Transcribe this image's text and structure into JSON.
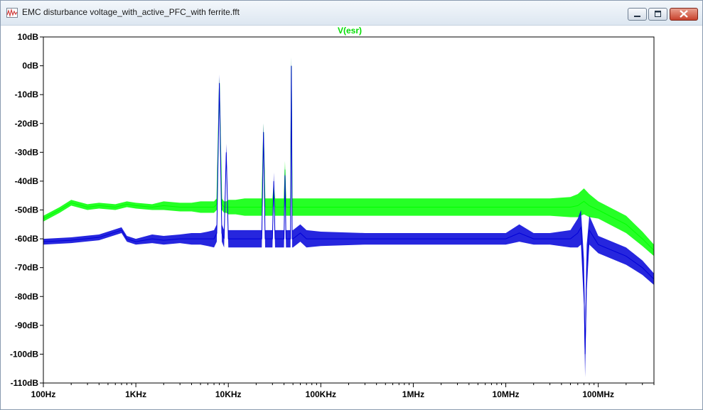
{
  "window": {
    "title": "EMC disturbance voltage_with_active_PFC_with ferrite.fft",
    "icons": {
      "app": "waveform-app-icon",
      "minimize": "minimize-icon",
      "maximize": "maximize-icon",
      "close": "close-icon"
    }
  },
  "chart_data": {
    "type": "line",
    "title": "V(esr)",
    "xscale": "log",
    "x_range": [
      100,
      400000000
    ],
    "y_range": [
      -110,
      10
    ],
    "x_ticks": [
      {
        "value": 100,
        "label": "100Hz"
      },
      {
        "value": 1000,
        "label": "1KHz"
      },
      {
        "value": 10000,
        "label": "10KHz"
      },
      {
        "value": 100000,
        "label": "100KHz"
      },
      {
        "value": 1000000,
        "label": "1MHz"
      },
      {
        "value": 10000000,
        "label": "10MHz"
      },
      {
        "value": 100000000,
        "label": "100MHz"
      }
    ],
    "y_ticks": [
      {
        "value": 10,
        "label": "10dB"
      },
      {
        "value": 0,
        "label": "0dB"
      },
      {
        "value": -10,
        "label": "-10dB"
      },
      {
        "value": -20,
        "label": "-20dB"
      },
      {
        "value": -30,
        "label": "-30dB"
      },
      {
        "value": -40,
        "label": "-40dB"
      },
      {
        "value": -50,
        "label": "-50dB"
      },
      {
        "value": -60,
        "label": "-60dB"
      },
      {
        "value": -70,
        "label": "-70dB"
      },
      {
        "value": -80,
        "label": "-80dB"
      },
      {
        "value": -90,
        "label": "-90dB"
      },
      {
        "value": -100,
        "label": "-100dB"
      },
      {
        "value": -110,
        "label": "-110dB"
      }
    ],
    "grid": false,
    "series": [
      {
        "color": "#00ff00",
        "x": [
          100,
          150,
          200,
          300,
          400,
          600,
          800,
          1000,
          1500,
          2000,
          3000,
          4000,
          5000,
          6000,
          7000,
          7500,
          8000,
          8500,
          9000,
          9500,
          10000,
          12000,
          15000,
          20000,
          23000,
          24000,
          25000,
          30000,
          31000,
          32000,
          40000,
          41000,
          42000,
          47000,
          48000,
          49000,
          50000,
          55000,
          60000,
          70000,
          100000,
          300000,
          1000000,
          3000000,
          10000000,
          30000000,
          50000000,
          60000000,
          70000000,
          80000000,
          100000000,
          200000000,
          300000000,
          400000000
        ],
        "y": [
          -53,
          -50,
          -47.5,
          -49,
          -48.5,
          -49,
          -48,
          -48.5,
          -49,
          -48.5,
          -49,
          -49,
          -49,
          -49,
          -49,
          -48,
          -6,
          -48,
          -49,
          -49,
          -49,
          -49,
          -49,
          -49,
          -49,
          -23,
          -49,
          -49,
          -43,
          -49,
          -49,
          -36,
          -49,
          -49,
          0,
          -49,
          -49,
          -49,
          -49,
          -49,
          -49,
          -49,
          -49,
          -49,
          -49,
          -49,
          -49,
          -48.5,
          -47,
          -48.5,
          -50,
          -55,
          -60,
          -64
        ],
        "band": [
          1,
          1,
          1,
          1,
          1,
          1,
          1,
          1,
          1,
          1.5,
          1.5,
          1.5,
          2,
          2,
          2,
          2,
          2,
          2,
          2,
          2,
          2.5,
          2.5,
          3,
          3,
          3,
          3,
          3,
          3,
          3,
          3,
          3,
          3,
          3,
          3,
          3,
          3,
          3,
          3,
          3,
          3,
          3,
          3,
          3,
          3,
          3,
          3,
          3.5,
          4,
          4.5,
          4,
          3,
          3,
          2.5,
          2
        ]
      },
      {
        "color": "#0000d8",
        "x": [
          100,
          200,
          400,
          700,
          800,
          1000,
          1500,
          2000,
          3000,
          4000,
          5000,
          6000,
          7000,
          7500,
          8000,
          8500,
          9000,
          9500,
          10000,
          12000,
          15000,
          20000,
          23000,
          24000,
          25000,
          30000,
          31000,
          32000,
          40000,
          41000,
          42000,
          47000,
          48000,
          49000,
          50000,
          60000,
          70000,
          100000,
          300000,
          1000000,
          3000000,
          10000000,
          14000000,
          20000000,
          30000000,
          50000000,
          60000000,
          65000000,
          70000000,
          72000000,
          75000000,
          80000000,
          100000000,
          200000000,
          300000000,
          400000000
        ],
        "y": [
          -61,
          -60.5,
          -59.5,
          -57,
          -60,
          -61,
          -60,
          -60.5,
          -60,
          -60,
          -60,
          -60,
          -60,
          -58,
          -6,
          -58,
          -60,
          -30,
          -60,
          -60,
          -60,
          -60,
          -60,
          -23,
          -60,
          -60,
          -40,
          -60,
          -60,
          -38,
          -60,
          -60,
          0,
          -60,
          -60,
          -58,
          -60,
          -60,
          -60,
          -60,
          -60,
          -60,
          -58,
          -60,
          -60,
          -60,
          -58,
          -56,
          -75,
          -100,
          -70,
          -57,
          -62,
          -66,
          -70,
          -74
        ],
        "band": [
          1,
          1,
          1,
          1,
          1,
          1,
          1.5,
          1.5,
          1.5,
          2,
          2,
          2.5,
          3,
          3,
          3,
          3,
          3,
          3,
          3,
          3,
          3,
          3,
          3,
          3,
          3,
          3,
          3,
          3,
          3,
          3,
          3,
          3,
          3,
          3,
          3,
          3,
          3,
          2.5,
          2,
          2,
          2,
          2,
          3,
          2,
          2,
          3,
          5,
          6,
          8,
          8,
          8,
          5,
          3,
          3,
          2.5,
          2
        ]
      }
    ]
  }
}
